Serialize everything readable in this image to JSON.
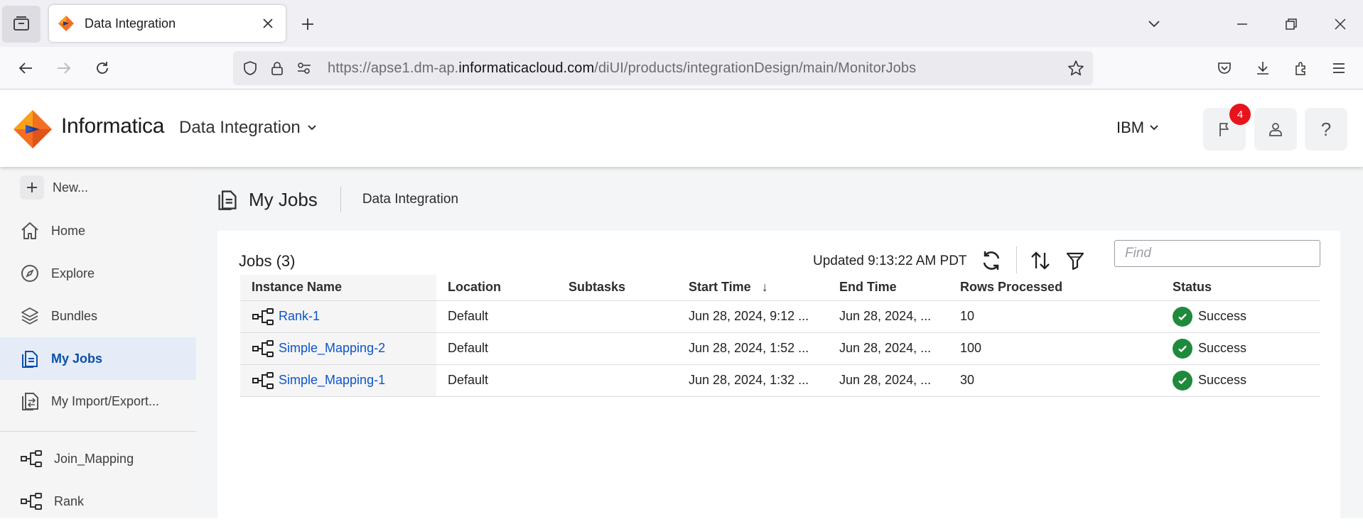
{
  "browser": {
    "tab_title": "Data Integration",
    "url_prefix": "https://apse1.dm-ap.",
    "url_domain": "informaticacloud.com",
    "url_path": "/diUI/products/integrationDesign/main/MonitorJobs"
  },
  "header": {
    "brand": "Informatica",
    "product": "Data Integration",
    "org": "IBM",
    "notification_count": "4",
    "help_label": "?"
  },
  "sidebar": {
    "new_label": "New...",
    "items": [
      {
        "label": "Home",
        "icon": "home-icon"
      },
      {
        "label": "Explore",
        "icon": "compass-icon"
      },
      {
        "label": "Bundles",
        "icon": "layers-icon"
      },
      {
        "label": "My Jobs",
        "icon": "jobs-icon",
        "active": true
      },
      {
        "label": "My Import/Export...",
        "icon": "import-export-icon"
      }
    ],
    "recent": [
      {
        "label": "Join_Mapping",
        "icon": "mapping-icon"
      },
      {
        "label": "Rank",
        "icon": "mapping-icon"
      }
    ]
  },
  "page": {
    "title": "My Jobs",
    "breadcrumb": "Data Integration"
  },
  "jobs": {
    "count_label": "Jobs (3)",
    "updated": "Updated 9:13:22 AM PDT",
    "find_placeholder": "Find",
    "columns": [
      "Instance Name",
      "Location",
      "Subtasks",
      "Start Time",
      "End Time",
      "Rows Processed",
      "Status"
    ],
    "sort_indicator": "↓",
    "rows": [
      {
        "name": "Rank-1",
        "location": "Default",
        "subtasks": "",
        "start": "Jun 28, 2024, 9:12 ...",
        "end": "Jun 28, 2024, ...",
        "rows": "10",
        "status": "Success"
      },
      {
        "name": "Simple_Mapping-2",
        "location": "Default",
        "subtasks": "",
        "start": "Jun 28, 2024, 1:52 ...",
        "end": "Jun 28, 2024, ...",
        "rows": "100",
        "status": "Success"
      },
      {
        "name": "Simple_Mapping-1",
        "location": "Default",
        "subtasks": "",
        "start": "Jun 28, 2024, 1:32 ...",
        "end": "Jun 28, 2024, ...",
        "rows": "30",
        "status": "Success"
      }
    ]
  },
  "colors": {
    "accent": "#0b55c8",
    "success": "#1f8a3b",
    "badge": "#e8141c",
    "active_bg": "#e5ecf8"
  }
}
